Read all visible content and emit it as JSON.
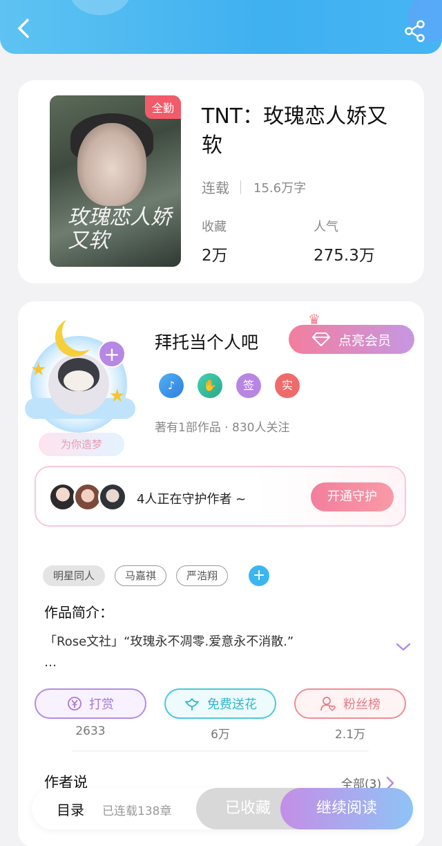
{
  "header": {
    "back_icon": "chevron-left-icon",
    "share_icon": "share-icon"
  },
  "book": {
    "badge": "全勤",
    "title": "TNT：玫瑰恋人娇又软",
    "cover_art_text": "玫瑰恋人娇又软",
    "status": "连载",
    "word_count": "15.6万字",
    "favorites_label": "收藏",
    "favorites_value": "2万",
    "popularity_label": "人气",
    "popularity_value": "275.3万"
  },
  "author": {
    "name": "拜托当个人吧",
    "vip_button": "点亮会员",
    "dream_tag": "为你造梦",
    "badges": [
      "签",
      "实"
    ],
    "meta": "著有1部作品 · 830人关注"
  },
  "guard": {
    "text": "4人正在守护作者 ~",
    "button": "开通守护"
  },
  "tags": [
    "明星同人",
    "马嘉祺",
    "严浩翔"
  ],
  "intro": {
    "title": "作品简介：",
    "line1": "「Rose文社」“玫瑰永不凋零.爱意永不消散.”",
    "line2": "…"
  },
  "actions": [
    {
      "label": "打赏",
      "count": "2633",
      "icon": "yen-icon"
    },
    {
      "label": "免费送花",
      "count": "6万",
      "icon": "flower-icon"
    },
    {
      "label": "粉丝榜",
      "count": "2.1万",
      "icon": "user-heart-icon"
    }
  ],
  "author_says": {
    "title": "作者说",
    "all_link": "全部(3)"
  },
  "bottom": {
    "toc": "目录",
    "chapters": "已连载138章",
    "collected": "已收藏",
    "continue": "继续阅读"
  },
  "colors": {
    "header": "#3fb0f0",
    "accent_pink": "#f37e9d",
    "accent_purple": "#c48ee6"
  }
}
